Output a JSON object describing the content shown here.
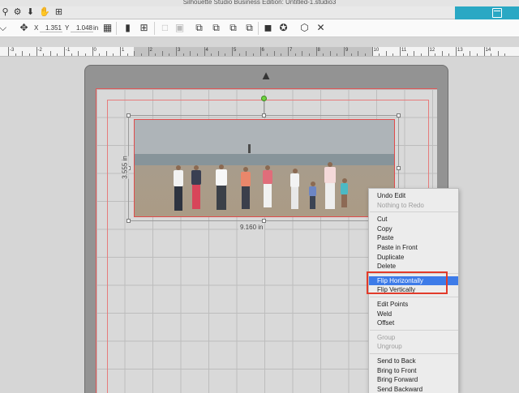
{
  "window": {
    "title": "Silhouette Studio Business Edition: Untitled-1.studio3"
  },
  "toolbar1": {
    "icons": [
      "zoom-icon",
      "pan-zoom-icon",
      "move-down-icon",
      "hand-icon",
      "grid-icon"
    ]
  },
  "toolbar2": {
    "x_label": "X",
    "x_value": "1.351",
    "y_label": "Y",
    "y_value": "1.048",
    "y_unit": "in"
  },
  "ruler": {
    "labels": [
      "-3",
      "-2",
      "-1",
      "0",
      "1",
      "2",
      "3",
      "4",
      "5",
      "6",
      "7",
      "8",
      "9",
      "10",
      "11",
      "12",
      "13",
      "14"
    ]
  },
  "selection": {
    "width_label": "9.160 in",
    "height_label": "3.555 in"
  },
  "context_menu": {
    "groups": [
      [
        {
          "label": "Undo Edit",
          "disabled": false
        },
        {
          "label": "Nothing to Redo",
          "disabled": true
        }
      ],
      [
        {
          "label": "Cut"
        },
        {
          "label": "Copy"
        },
        {
          "label": "Paste"
        },
        {
          "label": "Paste in Front"
        },
        {
          "label": "Duplicate"
        },
        {
          "label": "Delete"
        }
      ],
      [
        {
          "label": "Flip Horizontally",
          "highlighted": true
        },
        {
          "label": "Flip Vertically"
        }
      ],
      [
        {
          "label": "Edit Points"
        },
        {
          "label": "Weld"
        },
        {
          "label": "Offset"
        }
      ],
      [
        {
          "label": "Group",
          "disabled": true
        },
        {
          "label": "Ungroup",
          "disabled": true
        }
      ],
      [
        {
          "label": "Send to Back"
        },
        {
          "label": "Bring to Front"
        },
        {
          "label": "Bring Forward"
        },
        {
          "label": "Send Backward"
        }
      ]
    ]
  },
  "colors": {
    "highlight": "#3d7be8",
    "callout": "#e23b2a",
    "accent": "#2aa8c4",
    "cut_line": "#e04b4b"
  }
}
